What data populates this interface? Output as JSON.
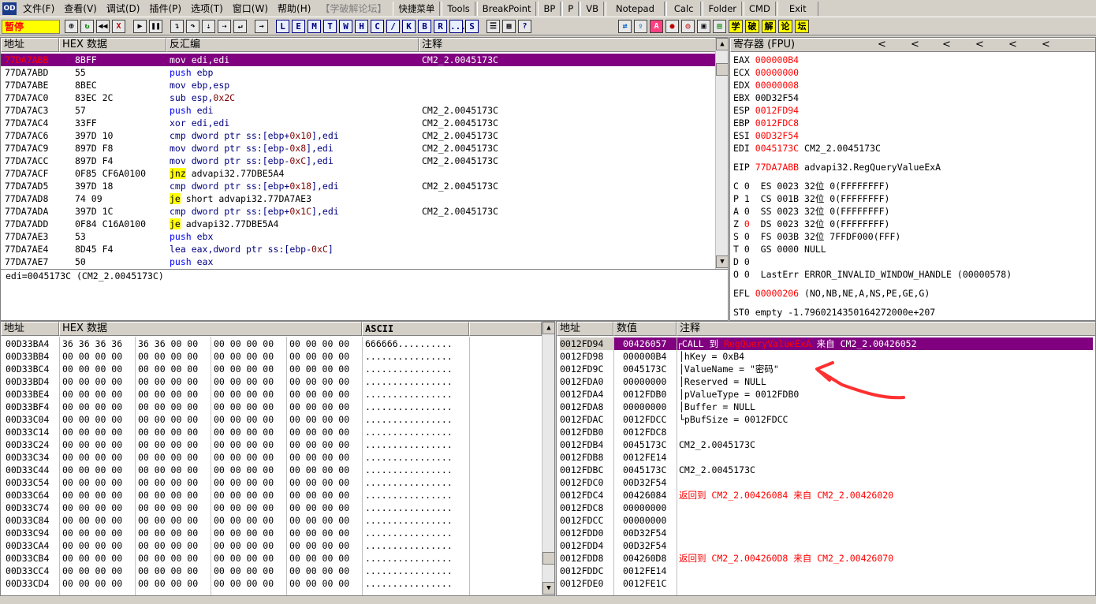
{
  "menu": {
    "items": [
      "文件(F)",
      "查看(V)",
      "调试(D)",
      "插件(P)",
      "选项(T)",
      "窗口(W)",
      "帮助(H)"
    ],
    "dim_item": "【学破解论坛】",
    "buttons": [
      "快捷菜单",
      "Tools",
      "BreakPoint",
      "BP",
      "P",
      "VB",
      "Notepad",
      "Calc",
      "Folder",
      "CMD",
      "Exit"
    ]
  },
  "toolbar": {
    "status": "暂停",
    "letter_buttons": [
      "L",
      "E",
      "M",
      "T",
      "W",
      "H",
      "C",
      "/",
      "K",
      "B",
      "R",
      "...",
      "S"
    ],
    "cn_buttons": [
      "学",
      "破",
      "解",
      "论",
      "坛"
    ]
  },
  "cpu": {
    "headers": {
      "address": "地址",
      "hex": "HEX 数据",
      "disasm": "反汇编",
      "comment": "注释"
    },
    "rows": [
      {
        "addr": "77DA7ABB",
        "hex": "8BFF",
        "asm": "mov edi,edi",
        "comment": "CM2_2.0045173C",
        "selected": true
      },
      {
        "addr": "77DA7ABD",
        "hex": "55",
        "asm": "push ebp",
        "comment": ""
      },
      {
        "addr": "77DA7ABE",
        "hex": "8BEC",
        "asm": "mov ebp,esp",
        "comment": ""
      },
      {
        "addr": "77DA7AC0",
        "hex": "83EC 2C",
        "asm": "sub esp,0x2C",
        "comment": ""
      },
      {
        "addr": "77DA7AC3",
        "hex": "57",
        "asm": "push edi",
        "comment": "CM2_2.0045173C"
      },
      {
        "addr": "77DA7AC4",
        "hex": "33FF",
        "asm": "xor edi,edi",
        "comment": "CM2_2.0045173C"
      },
      {
        "addr": "77DA7AC6",
        "hex": "397D 10",
        "asm": "cmp dword ptr ss:[ebp+0x10],edi",
        "comment": "CM2_2.0045173C"
      },
      {
        "addr": "77DA7AC9",
        "hex": "897D F8",
        "asm": "mov dword ptr ss:[ebp-0x8],edi",
        "comment": "CM2_2.0045173C"
      },
      {
        "addr": "77DA7ACC",
        "hex": "897D F4",
        "asm": "mov dword ptr ss:[ebp-0xC],edi",
        "comment": "CM2_2.0045173C"
      },
      {
        "addr": "77DA7ACF",
        "hex": "0F85 CF6A0100",
        "asm": "jnz advapi32.77DBE5A4",
        "comment": ""
      },
      {
        "addr": "77DA7AD5",
        "hex": "397D 18",
        "asm": "cmp dword ptr ss:[ebp+0x18],edi",
        "comment": "CM2_2.0045173C"
      },
      {
        "addr": "77DA7AD8",
        "hex": "74 09",
        "asm": "je short advapi32.77DA7AE3",
        "comment": ""
      },
      {
        "addr": "77DA7ADA",
        "hex": "397D 1C",
        "asm": "cmp dword ptr ss:[ebp+0x1C],edi",
        "comment": "CM2_2.0045173C"
      },
      {
        "addr": "77DA7ADD",
        "hex": "0F84 C16A0100",
        "asm": "je advapi32.77DBE5A4",
        "comment": ""
      },
      {
        "addr": "77DA7AE3",
        "hex": "53",
        "asm": "push ebx",
        "comment": ""
      },
      {
        "addr": "77DA7AE4",
        "hex": "8D45 F4",
        "asm": "lea eax,dword ptr ss:[ebp-0xC]",
        "comment": ""
      },
      {
        "addr": "77DA7AE7",
        "hex": "50",
        "asm": "push eax",
        "comment": ""
      }
    ],
    "info_line": "edi=0045173C (CM2_2.0045173C)"
  },
  "registers": {
    "title": "寄存器 (FPU)",
    "nav_arrows": [
      "<",
      "<",
      "<",
      "<",
      "<",
      "<"
    ],
    "lines": [
      {
        "name": "EAX",
        "value": "000000B4",
        "note": "",
        "red": true
      },
      {
        "name": "ECX",
        "value": "00000000",
        "note": "",
        "red": true
      },
      {
        "name": "EDX",
        "value": "00000008",
        "note": "",
        "red": true
      },
      {
        "name": "EBX",
        "value": "00D32F54",
        "note": "",
        "red": false
      },
      {
        "name": "ESP",
        "value": "0012FD94",
        "note": "",
        "red": true
      },
      {
        "name": "EBP",
        "value": "0012FDC8",
        "note": "",
        "red": true
      },
      {
        "name": "ESI",
        "value": "00D32F54",
        "note": "",
        "red": true
      },
      {
        "name": "EDI",
        "value": "0045173C",
        "note": "CM2_2.0045173C",
        "red": true
      }
    ],
    "eip": {
      "name": "EIP",
      "value": "77DA7ABB",
      "note": "advapi32.RegQueryValueExA"
    },
    "flags": [
      {
        "flag": "C",
        "val": "0",
        "seg": "ES 0023 32位 0(FFFFFFFF)",
        "red": false
      },
      {
        "flag": "P",
        "val": "1",
        "seg": "CS 001B 32位 0(FFFFFFFF)",
        "red": false
      },
      {
        "flag": "A",
        "val": "0",
        "seg": "SS 0023 32位 0(FFFFFFFF)",
        "red": false
      },
      {
        "flag": "Z",
        "val": "0",
        "seg": "DS 0023 32位 0(FFFFFFFF)",
        "red": true
      },
      {
        "flag": "S",
        "val": "0",
        "seg": "FS 003B 32位 7FFDF000(FFF)",
        "red": false
      },
      {
        "flag": "T",
        "val": "0",
        "seg": "GS 0000 NULL",
        "red": false
      },
      {
        "flag": "D",
        "val": "0",
        "seg": "",
        "red": false
      },
      {
        "flag": "O",
        "val": "0",
        "seg": "LastErr ERROR_INVALID_WINDOW_HANDLE (00000578)",
        "red": false
      }
    ],
    "efl": {
      "name": "EFL",
      "value": "00000206",
      "note": "(NO,NB,NE,A,NS,PE,GE,G)"
    },
    "st0": "ST0 empty -1.7960214350164272000e+207"
  },
  "dump": {
    "headers": {
      "address": "地址",
      "hex": "HEX 数据",
      "ascii": "ASCII"
    },
    "rows": [
      {
        "addr": "00D33BA4",
        "hex": [
          "36 36 36 36",
          "36 36 00 00",
          "00 00 00 00",
          "00 00 00 00"
        ],
        "ascii": "666666.........."
      },
      {
        "addr": "00D33BB4",
        "hex": [
          "00 00 00 00",
          "00 00 00 00",
          "00 00 00 00",
          "00 00 00 00"
        ],
        "ascii": "................"
      },
      {
        "addr": "00D33BC4",
        "hex": [
          "00 00 00 00",
          "00 00 00 00",
          "00 00 00 00",
          "00 00 00 00"
        ],
        "ascii": "................"
      },
      {
        "addr": "00D33BD4",
        "hex": [
          "00 00 00 00",
          "00 00 00 00",
          "00 00 00 00",
          "00 00 00 00"
        ],
        "ascii": "................"
      },
      {
        "addr": "00D33BE4",
        "hex": [
          "00 00 00 00",
          "00 00 00 00",
          "00 00 00 00",
          "00 00 00 00"
        ],
        "ascii": "................"
      },
      {
        "addr": "00D33BF4",
        "hex": [
          "00 00 00 00",
          "00 00 00 00",
          "00 00 00 00",
          "00 00 00 00"
        ],
        "ascii": "................"
      },
      {
        "addr": "00D33C04",
        "hex": [
          "00 00 00 00",
          "00 00 00 00",
          "00 00 00 00",
          "00 00 00 00"
        ],
        "ascii": "................"
      },
      {
        "addr": "00D33C14",
        "hex": [
          "00 00 00 00",
          "00 00 00 00",
          "00 00 00 00",
          "00 00 00 00"
        ],
        "ascii": "................"
      },
      {
        "addr": "00D33C24",
        "hex": [
          "00 00 00 00",
          "00 00 00 00",
          "00 00 00 00",
          "00 00 00 00"
        ],
        "ascii": "................"
      },
      {
        "addr": "00D33C34",
        "hex": [
          "00 00 00 00",
          "00 00 00 00",
          "00 00 00 00",
          "00 00 00 00"
        ],
        "ascii": "................"
      },
      {
        "addr": "00D33C44",
        "hex": [
          "00 00 00 00",
          "00 00 00 00",
          "00 00 00 00",
          "00 00 00 00"
        ],
        "ascii": "................"
      },
      {
        "addr": "00D33C54",
        "hex": [
          "00 00 00 00",
          "00 00 00 00",
          "00 00 00 00",
          "00 00 00 00"
        ],
        "ascii": "................"
      },
      {
        "addr": "00D33C64",
        "hex": [
          "00 00 00 00",
          "00 00 00 00",
          "00 00 00 00",
          "00 00 00 00"
        ],
        "ascii": "................"
      },
      {
        "addr": "00D33C74",
        "hex": [
          "00 00 00 00",
          "00 00 00 00",
          "00 00 00 00",
          "00 00 00 00"
        ],
        "ascii": "................"
      },
      {
        "addr": "00D33C84",
        "hex": [
          "00 00 00 00",
          "00 00 00 00",
          "00 00 00 00",
          "00 00 00 00"
        ],
        "ascii": "................"
      },
      {
        "addr": "00D33C94",
        "hex": [
          "00 00 00 00",
          "00 00 00 00",
          "00 00 00 00",
          "00 00 00 00"
        ],
        "ascii": "................"
      },
      {
        "addr": "00D33CA4",
        "hex": [
          "00 00 00 00",
          "00 00 00 00",
          "00 00 00 00",
          "00 00 00 00"
        ],
        "ascii": "................"
      },
      {
        "addr": "00D33CB4",
        "hex": [
          "00 00 00 00",
          "00 00 00 00",
          "00 00 00 00",
          "00 00 00 00"
        ],
        "ascii": "................"
      },
      {
        "addr": "00D33CC4",
        "hex": [
          "00 00 00 00",
          "00 00 00 00",
          "00 00 00 00",
          "00 00 00 00"
        ],
        "ascii": "................"
      },
      {
        "addr": "00D33CD4",
        "hex": [
          "00 00 00 00",
          "00 00 00 00",
          "00 00 00 00",
          "00 00 00 00"
        ],
        "ascii": "................"
      }
    ]
  },
  "stack": {
    "headers": {
      "address": "地址",
      "value": "数值",
      "comment": "注释"
    },
    "rows": [
      {
        "addr": "0012FD94",
        "val": "00426057",
        "comment": "CALL 到 RegQueryValueExA 来自 CM2_2.00426052",
        "kind": "sel"
      },
      {
        "addr": "0012FD98",
        "val": "000000B4",
        "comment": "hKey = 0xB4",
        "kind": "arg"
      },
      {
        "addr": "0012FD9C",
        "val": "0045173C",
        "comment": "ValueName = \"密码\"",
        "kind": "arg"
      },
      {
        "addr": "0012FDA0",
        "val": "00000000",
        "comment": "Reserved = NULL",
        "kind": "arg"
      },
      {
        "addr": "0012FDA4",
        "val": "0012FDB0",
        "comment": "pValueType = 0012FDB0",
        "kind": "arg"
      },
      {
        "addr": "0012FDA8",
        "val": "00000000",
        "comment": "Buffer = NULL",
        "kind": "arg"
      },
      {
        "addr": "0012FDAC",
        "val": "0012FDCC",
        "comment": "pBufSize = 0012FDCC",
        "kind": "argend"
      },
      {
        "addr": "0012FDB0",
        "val": "0012FDC8",
        "comment": "",
        "kind": "plain"
      },
      {
        "addr": "0012FDB4",
        "val": "0045173C",
        "comment": "CM2_2.0045173C",
        "kind": "plain"
      },
      {
        "addr": "0012FDB8",
        "val": "0012FE14",
        "comment": "",
        "kind": "plain"
      },
      {
        "addr": "0012FDBC",
        "val": "0045173C",
        "comment": "CM2_2.0045173C",
        "kind": "plain"
      },
      {
        "addr": "0012FDC0",
        "val": "00D32F54",
        "comment": "",
        "kind": "plain"
      },
      {
        "addr": "0012FDC4",
        "val": "00426084",
        "comment": "返回到 CM2_2.00426084 来自 CM2_2.00426020",
        "kind": "ret"
      },
      {
        "addr": "0012FDC8",
        "val": "00000000",
        "comment": "",
        "kind": "plain"
      },
      {
        "addr": "0012FDCC",
        "val": "00000000",
        "comment": "",
        "kind": "plain"
      },
      {
        "addr": "0012FDD0",
        "val": "00D32F54",
        "comment": "",
        "kind": "plain"
      },
      {
        "addr": "0012FDD4",
        "val": "00D32F54",
        "comment": "",
        "kind": "plain"
      },
      {
        "addr": "0012FDD8",
        "val": "004260D8",
        "comment": "返回到 CM2_2.004260D8 来自 CM2_2.00426070",
        "kind": "ret"
      },
      {
        "addr": "0012FDDC",
        "val": "0012FE14",
        "comment": "",
        "kind": "plain"
      },
      {
        "addr": "0012FDE0",
        "val": "0012FE1C",
        "comment": "",
        "kind": "plain"
      }
    ]
  },
  "annotation": {
    "color": "#ff3030"
  },
  "colors": {
    "selection": "#800080",
    "red": "#ff0000",
    "keyword": "#0000ff",
    "jump_bg": "#ffff00"
  }
}
